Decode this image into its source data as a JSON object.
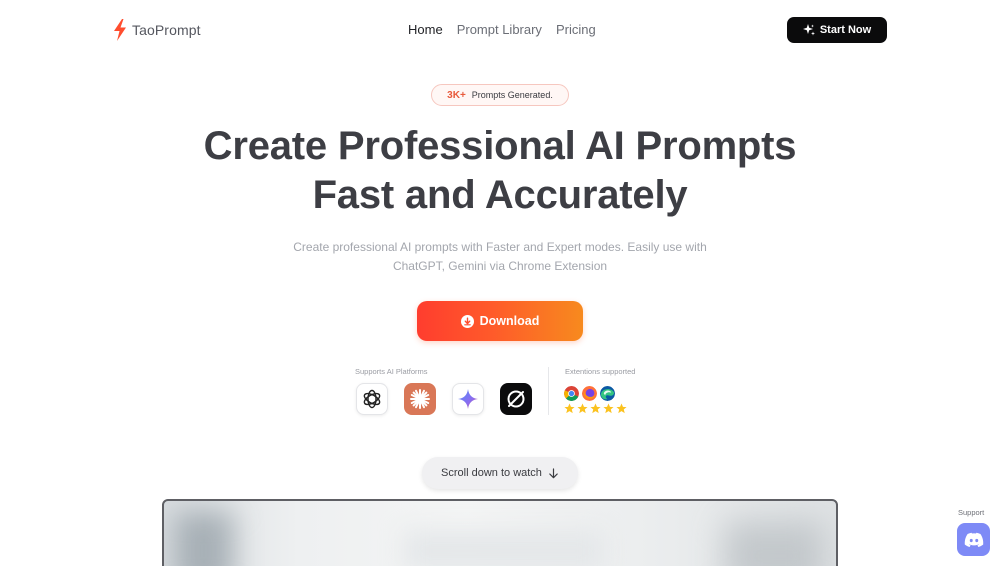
{
  "brand": {
    "name": "TaoPrompt",
    "accent": "#ff4d2e"
  },
  "nav": {
    "items": [
      {
        "label": "Home",
        "active": true
      },
      {
        "label": "Prompt Library",
        "active": false
      },
      {
        "label": "Pricing",
        "active": false
      }
    ],
    "cta_label": "Start Now"
  },
  "badge": {
    "count": "3K+",
    "text": "Prompts Generated."
  },
  "hero": {
    "headline_line1": "Create Professional AI Prompts",
    "headline_line2": "Fast and Accurately",
    "subtitle_line1": "Create professional AI prompts with Faster and Expert modes. Easily use with",
    "subtitle_line2": "ChatGPT, Gemini via Chrome Extension",
    "download_label": "Download",
    "download_gradient": [
      "#ff3d2e",
      "#f78a1e"
    ]
  },
  "platforms": {
    "label": "Supports AI Platforms",
    "icons": [
      "openai-icon",
      "claude-icon",
      "gemini-icon",
      "perplexity-icon"
    ]
  },
  "extensions": {
    "label": "Extentions supported",
    "icons": [
      "chrome-icon",
      "firefox-icon",
      "edge-icon"
    ],
    "rating_stars": 5
  },
  "scroll": {
    "label": "Scroll down to watch"
  },
  "support": {
    "label": "Support",
    "icon": "discord-icon",
    "color": "#7e8af6"
  }
}
